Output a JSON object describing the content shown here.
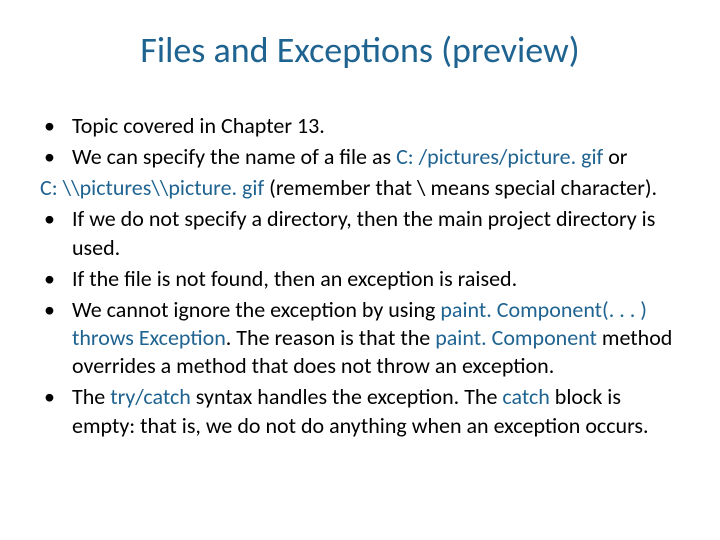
{
  "title": "Files and Exceptions (preview)",
  "bullets": {
    "b1": "Topic covered in Chapter 13.",
    "b2a": "We can specify the name of a file as ",
    "b2_path1": "C: /pictures/picture. gif",
    "b2b": " or",
    "b2_cont_path2": "C: \\\\pictures\\\\picture. gif",
    "b2_cont_rest": " (remember that \\ means special character).",
    "b3": "If we do not specify a directory, then the main project directory is used.",
    "b4": "If the file is not found, then an exception is raised.",
    "b5a": "We cannot ignore the exception by using ",
    "b5_hl1": "paint. Component(. . . ) throws Exception",
    "b5b": ". The reason is that the ",
    "b5_hl2": "paint. Component",
    "b5c": " method overrides a method that does not throw an exception.",
    "b6a": "The ",
    "b6_hl1": "try/catch",
    "b6b": " syntax handles the exception. The ",
    "b6_hl2": "catch",
    "b6c": " block is empty: that is, we do not do anything when an exception occurs."
  },
  "glyph": "•"
}
